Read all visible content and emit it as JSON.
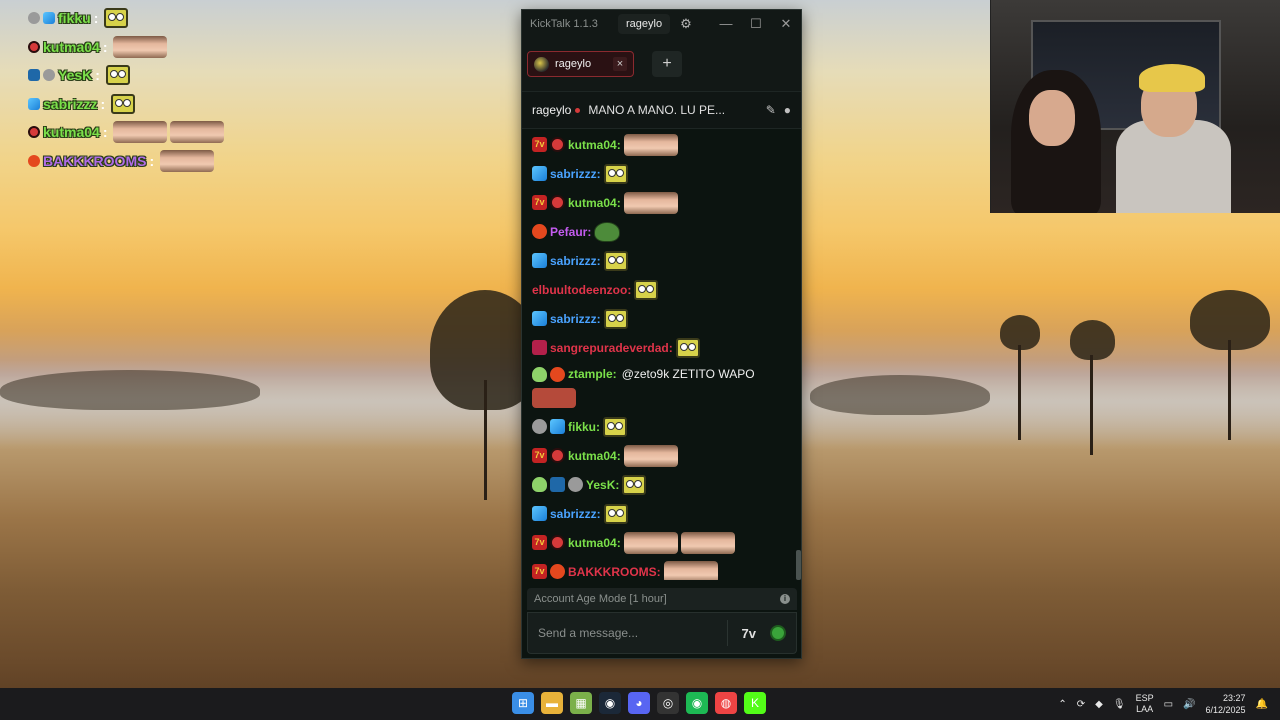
{
  "overlay_chat": [
    {
      "name": "fikku",
      "color": "#7be04a",
      "badges": [
        "grey",
        "cube"
      ],
      "emotes": [
        "sb"
      ]
    },
    {
      "name": "kutma04",
      "color": "#7be04a",
      "badges": [
        "teeth"
      ],
      "emotes": [
        "face"
      ]
    },
    {
      "name": "YesK",
      "color": "#7be04a",
      "badges": [
        "sword",
        "grey"
      ],
      "emotes": [
        "sb"
      ]
    },
    {
      "name": "sabrizzz",
      "color": "#7be04a",
      "badges": [
        "cube"
      ],
      "emotes": [
        "sb"
      ]
    },
    {
      "name": "kutma04",
      "color": "#7be04a",
      "badges": [
        "teeth"
      ],
      "emotes": [
        "face",
        "face"
      ]
    },
    {
      "name": "BAKKKROOMS",
      "color": "#b06ce6",
      "badges": [
        "red"
      ],
      "emotes": [
        "face"
      ]
    }
  ],
  "kicktalk": {
    "app_title": "KickTalk 1.1.3",
    "user": "rageylo",
    "tab_label": "rageylo",
    "tab_close": "×",
    "add_tab": "+",
    "streamer": "rageylo",
    "stream_title": "MANO A MANO. LU PE...",
    "account_mode": "Account Age Mode [1 hour]",
    "input_placeholder": "Send a message...",
    "messages": [
      {
        "name": "kutma04",
        "color": "#7be04a",
        "badges": [
          "hz",
          "teeth"
        ],
        "text": "",
        "emotes": [
          "face"
        ]
      },
      {
        "name": "sabrizzz",
        "color": "#4aa3ff",
        "badges": [
          "cube"
        ],
        "text": "",
        "emotes": [
          "sb"
        ]
      },
      {
        "name": "kutma04",
        "color": "#7be04a",
        "badges": [
          "hz",
          "teeth"
        ],
        "text": "",
        "emotes": [
          "face"
        ]
      },
      {
        "name": "Pefaur",
        "color": "#c45cf0",
        "badges": [
          "red"
        ],
        "text": "",
        "emotes": [
          "pepe"
        ]
      },
      {
        "name": "sabrizzz",
        "color": "#4aa3ff",
        "badges": [
          "cube"
        ],
        "text": "",
        "emotes": [
          "sb"
        ]
      },
      {
        "name": "elbuultodeenzoo",
        "color": "#e0344a",
        "badges": [],
        "text": "",
        "emotes": [
          "sb"
        ]
      },
      {
        "name": "sabrizzz",
        "color": "#4aa3ff",
        "badges": [
          "cube"
        ],
        "text": "",
        "emotes": [
          "sb"
        ]
      },
      {
        "name": "sangrepuradeverdad",
        "color": "#e0344a",
        "badges": [
          "sang"
        ],
        "text": "",
        "emotes": [
          "sb"
        ]
      },
      {
        "name": "ztample",
        "color": "#7be04a",
        "badges": [
          "alien",
          "red"
        ],
        "text": "@zeto9k ZETITO WAPO",
        "emotes": [
          "face"
        ],
        "tall": true
      },
      {
        "name": "fikku",
        "color": "#7be04a",
        "badges": [
          "grey",
          "cube"
        ],
        "text": "",
        "emotes": [
          "sb"
        ]
      },
      {
        "name": "kutma04",
        "color": "#7be04a",
        "badges": [
          "hz",
          "teeth"
        ],
        "text": "",
        "emotes": [
          "face"
        ]
      },
      {
        "name": "YesK",
        "color": "#7be04a",
        "badges": [
          "alien",
          "sword",
          "grey"
        ],
        "text": "",
        "emotes": [
          "sb"
        ]
      },
      {
        "name": "sabrizzz",
        "color": "#4aa3ff",
        "badges": [
          "cube"
        ],
        "text": "",
        "emotes": [
          "sb"
        ]
      },
      {
        "name": "kutma04",
        "color": "#7be04a",
        "badges": [
          "hz",
          "teeth"
        ],
        "text": "",
        "emotes": [
          "face",
          "face"
        ]
      },
      {
        "name": "BAKKKROOMS",
        "color": "#e0344a",
        "badges": [
          "hz",
          "red"
        ],
        "text": "",
        "emotes": [
          "face"
        ]
      }
    ]
  },
  "taskbar": {
    "apps": [
      "windows-start-icon",
      "file-explorer-icon",
      "app-icon",
      "steam-icon",
      "discord-icon",
      "obs-icon",
      "spotify-icon",
      "chrome-icon",
      "kicktalk-icon"
    ],
    "lang_top": "ESP",
    "lang_bottom": "LAA",
    "time": "23:27",
    "date": "6/12/2025"
  }
}
